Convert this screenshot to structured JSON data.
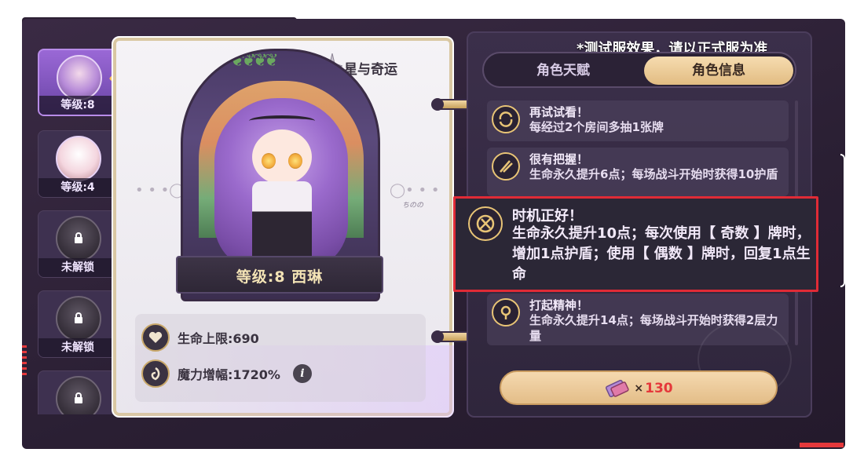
{
  "notice": "*测试服效果，请以正式服为准",
  "sidebar": {
    "characters": [
      {
        "label": "等级:8",
        "state": "active"
      },
      {
        "label": "等级:4",
        "state": "unlocked"
      },
      {
        "label": "未解锁",
        "state": "locked"
      },
      {
        "label": "未解锁",
        "state": "locked"
      },
      {
        "label": "",
        "state": "locked"
      }
    ]
  },
  "character": {
    "set_title": "星与奇运",
    "level_name": "等级:8  西琳",
    "signature": "ちのの"
  },
  "stats": {
    "hp_label": "生命上限:690",
    "magic_label": "魔力增幅:1720%"
  },
  "tabs": {
    "talent": "角色天赋",
    "info": "角色信息",
    "active": "角色信息"
  },
  "talents": [
    {
      "title": "再试试看！",
      "desc": "每经过2个房间多抽1张牌"
    },
    {
      "title": "很有把握！",
      "desc": "生命永久提升6点；每场战斗开始时获得10护盾"
    },
    {
      "title": "时机正好！",
      "desc": "生命永久提升10点；每次使用【 奇数 】牌时，增加1点护盾；使用【 偶数 】牌时，回复1点生命"
    },
    {
      "title": "打起精神！",
      "desc": "生命永久提升14点；每场战斗开始时获得2层力量"
    }
  ],
  "cost": {
    "prefix": "×",
    "value": "130"
  },
  "colors": {
    "accent_gold": "#e3bd88",
    "highlight_red": "#e02b36",
    "frame_purple": "#2a1f33"
  }
}
